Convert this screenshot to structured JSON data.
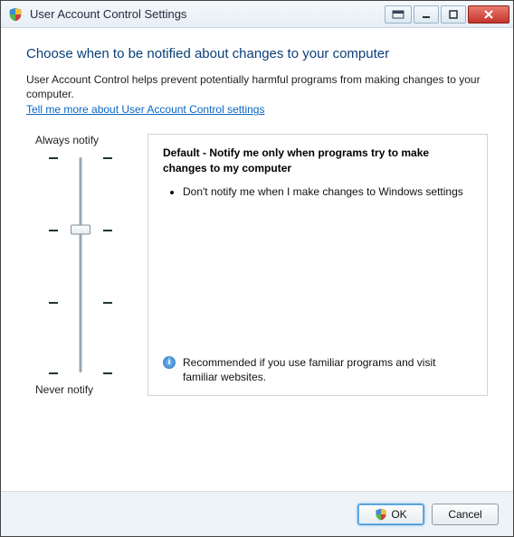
{
  "window": {
    "title": "User Account Control Settings"
  },
  "main": {
    "heading": "Choose when to be notified about changes to your computer",
    "description": "User Account Control helps prevent potentially harmful programs from making changes to your computer.",
    "help_link": "Tell me more about User Account Control settings"
  },
  "slider": {
    "top_label": "Always notify",
    "bottom_label": "Never notify",
    "level_count": 4,
    "selected_index": 1
  },
  "panel": {
    "title": "Default - Notify me only when programs try to make changes to my computer",
    "bullet1": "Don't notify me when I make changes to Windows settings",
    "recommendation": "Recommended if you use familiar programs and visit familiar websites."
  },
  "footer": {
    "ok_label": "OK",
    "cancel_label": "Cancel"
  }
}
